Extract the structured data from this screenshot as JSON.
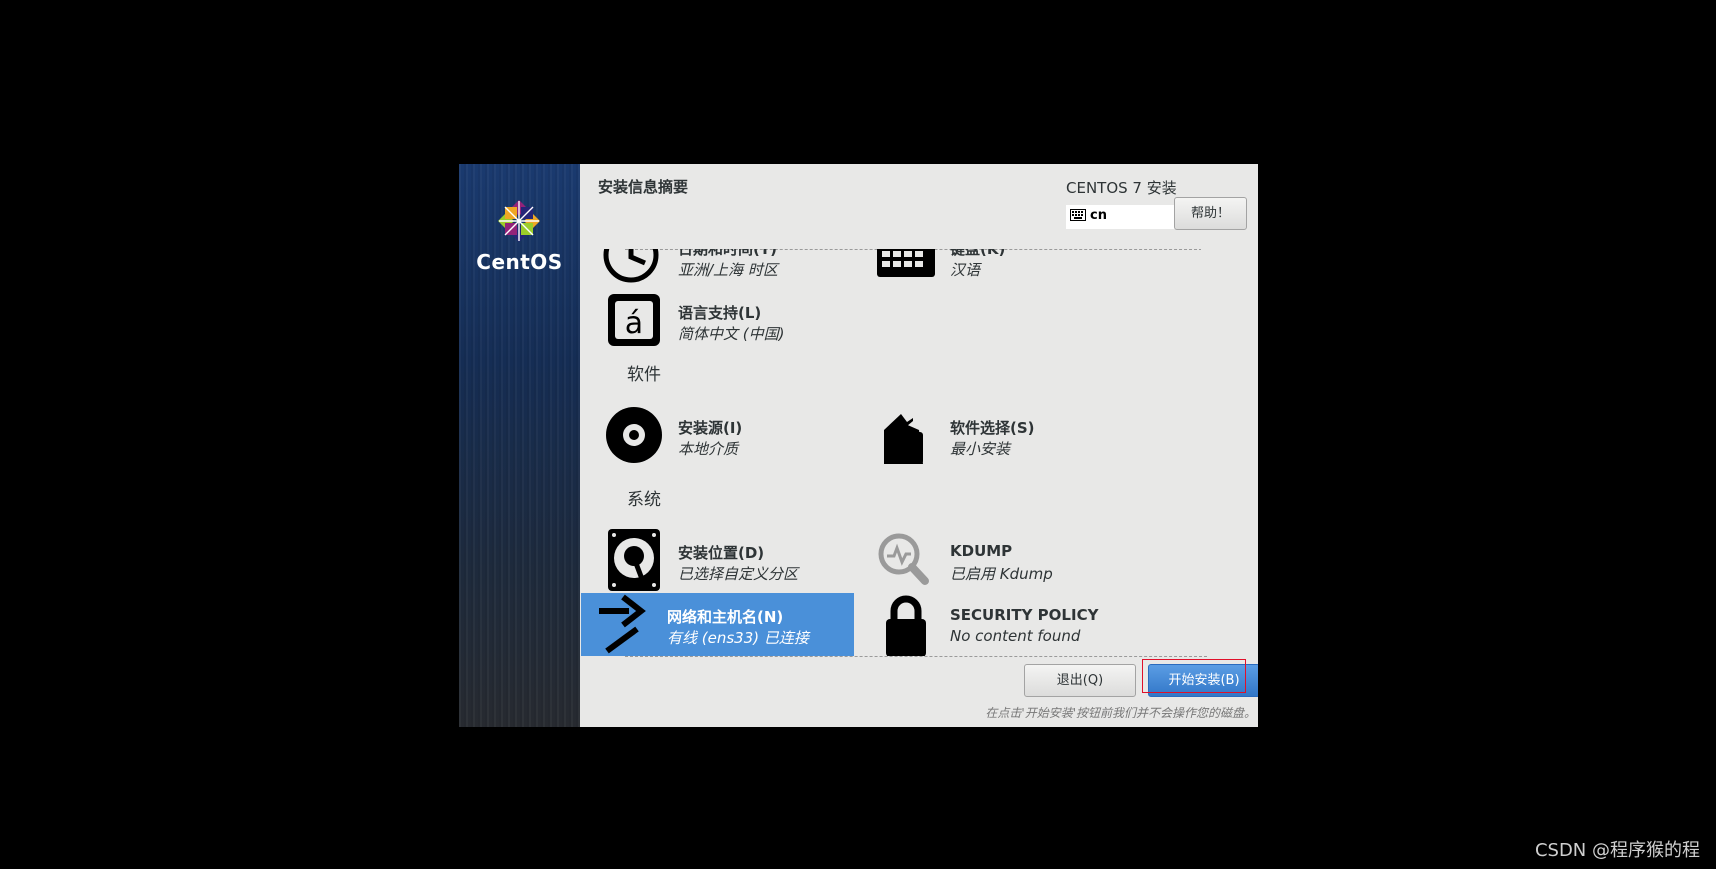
{
  "sidebar": {
    "logo_text": "CentOS"
  },
  "header": {
    "title": "安装信息摘要",
    "product": "CENTOS 7 安装",
    "keyboard_layout": "cn",
    "help_label": "帮助！"
  },
  "sections": [
    {
      "label": "软件"
    },
    {
      "label": "系统"
    }
  ],
  "spokes": {
    "datetime": {
      "title": "日期和时间(T)",
      "status": "亚洲/上海 时区",
      "icon": "clock-icon"
    },
    "keyboard": {
      "title": "键盘(K)",
      "status": "汉语",
      "icon": "keyboard-icon"
    },
    "language": {
      "title": "语言支持(L)",
      "status": "简体中文 (中国)",
      "icon": "language-icon"
    },
    "source": {
      "title": "安装源(I)",
      "status": "本地介质",
      "icon": "disc-icon"
    },
    "software": {
      "title": "软件选择(S)",
      "status": "最小安装",
      "icon": "package-icon"
    },
    "destination": {
      "title": "安装位置(D)",
      "status": "已选择自定义分区",
      "icon": "harddisk-icon"
    },
    "kdump": {
      "title": "KDUMP",
      "status": "已启用 Kdump",
      "icon": "magnifier-icon"
    },
    "network": {
      "title": "网络和主机名(N)",
      "status": "有线 (ens33) 已连接",
      "icon": "network-arrows-icon"
    },
    "security": {
      "title": "SECURITY POLICY",
      "status": "No content found",
      "icon": "lock-icon"
    }
  },
  "footer": {
    "quit_label": "退出(Q)",
    "begin_label": "开始安装(B)",
    "note": "在点击'开始安装'按钮前我们并不会操作您的磁盘。"
  },
  "watermark": "CSDN @程序猴的程",
  "colors": {
    "selected": "#4a90d9",
    "primary_button": "#3277c8",
    "highlight": "#e0102a"
  }
}
